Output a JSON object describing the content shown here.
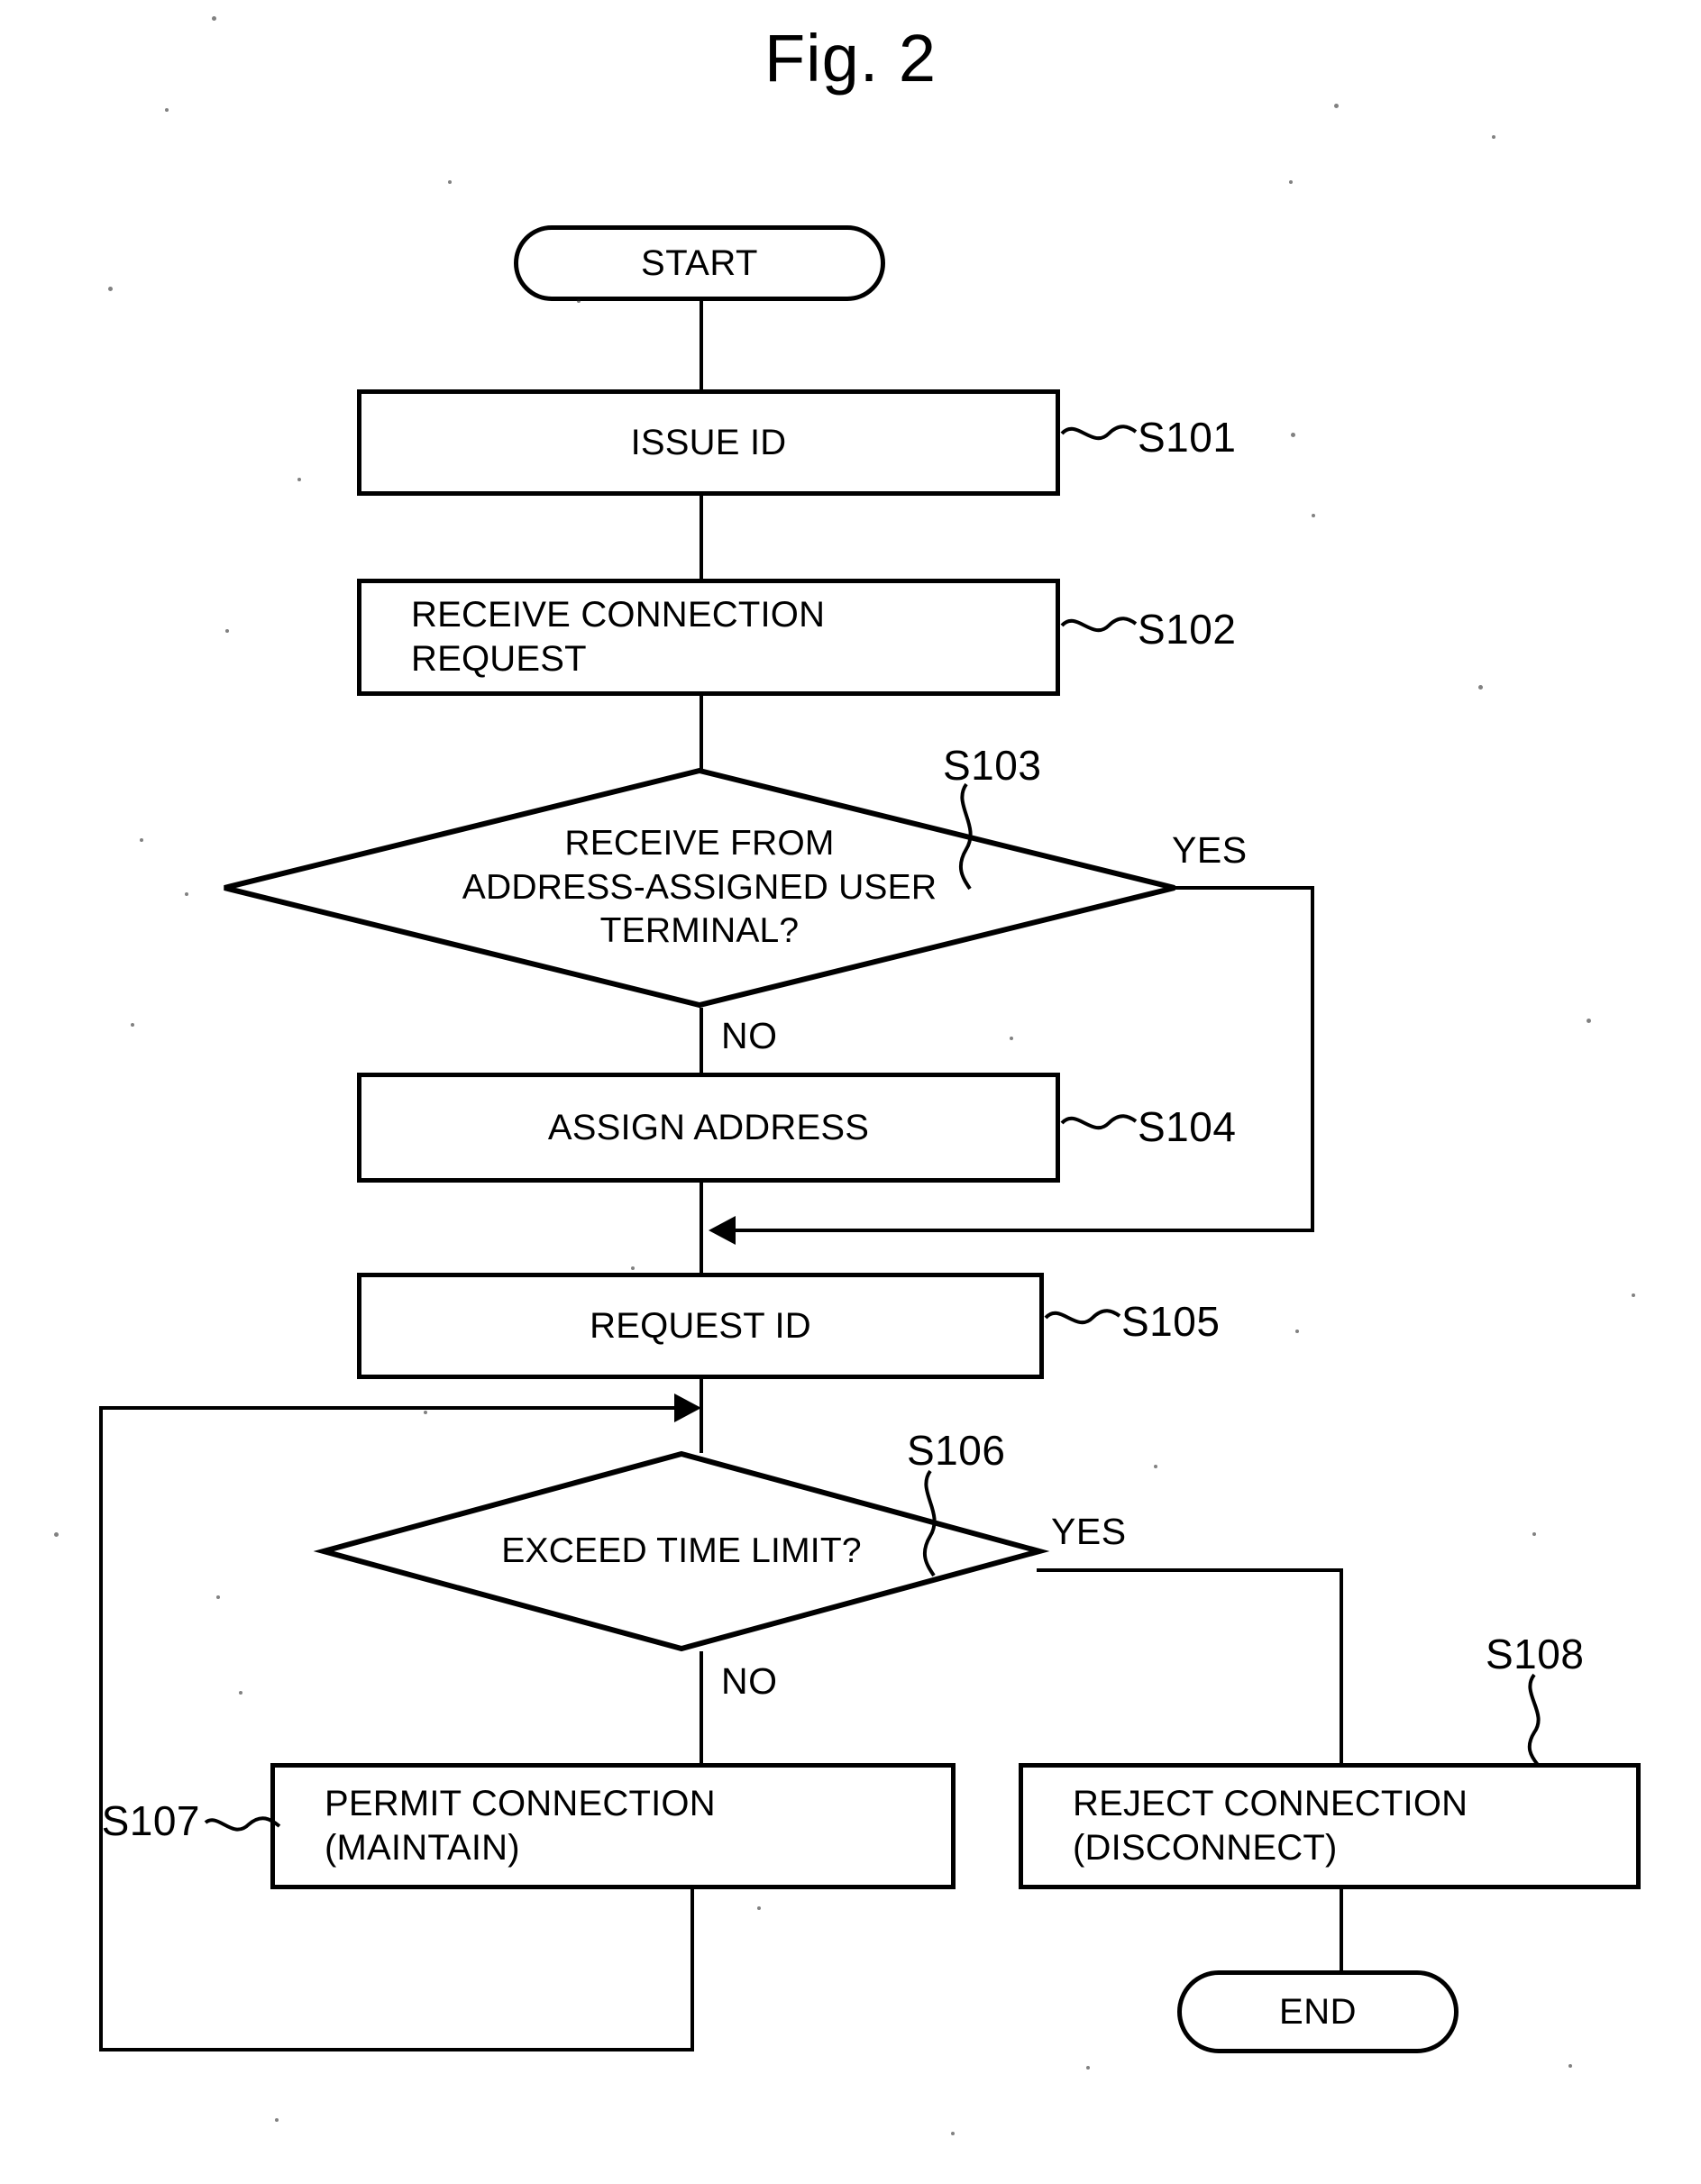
{
  "figure": {
    "title": "Fig. 2",
    "type": "flowchart"
  },
  "nodes": {
    "start": {
      "label": "START",
      "shape": "terminal"
    },
    "s101": {
      "label": "ISSUE ID",
      "shape": "process",
      "step": "S101"
    },
    "s102": {
      "label": "RECEIVE CONNECTION\nREQUEST",
      "shape": "process",
      "step": "S102"
    },
    "s103": {
      "label": "RECEIVE FROM\nADDRESS-ASSIGNED USER\nTERMINAL?",
      "shape": "decision",
      "step": "S103"
    },
    "s104": {
      "label": "ASSIGN ADDRESS",
      "shape": "process",
      "step": "S104"
    },
    "s105": {
      "label": "REQUEST ID",
      "shape": "process",
      "step": "S105"
    },
    "s106": {
      "label": "EXCEED TIME LIMIT?",
      "shape": "decision",
      "step": "S106"
    },
    "s107": {
      "label": "PERMIT CONNECTION\n(MAINTAIN)",
      "shape": "process",
      "step": "S107"
    },
    "s108": {
      "label": "REJECT CONNECTION\n(DISCONNECT)",
      "shape": "process",
      "step": "S108"
    },
    "end": {
      "label": "END",
      "shape": "terminal"
    }
  },
  "branch_labels": {
    "s103_yes": "YES",
    "s103_no": "NO",
    "s106_yes": "YES",
    "s106_no": "NO"
  },
  "edges": [
    {
      "from": "start",
      "to": "s101",
      "label": ""
    },
    {
      "from": "s101",
      "to": "s102",
      "label": ""
    },
    {
      "from": "s102",
      "to": "s103",
      "label": ""
    },
    {
      "from": "s103",
      "to": "s104",
      "label": "NO"
    },
    {
      "from": "s103",
      "to": "s105",
      "label": "YES"
    },
    {
      "from": "s104",
      "to": "s105",
      "label": ""
    },
    {
      "from": "s105",
      "to": "s106",
      "label": ""
    },
    {
      "from": "s106",
      "to": "s107",
      "label": "NO"
    },
    {
      "from": "s106",
      "to": "s108",
      "label": "YES"
    },
    {
      "from": "s107",
      "to": "s106",
      "label": ""
    },
    {
      "from": "s108",
      "to": "end",
      "label": ""
    }
  ],
  "colors": {
    "stroke": "#000000",
    "background": "#ffffff"
  }
}
